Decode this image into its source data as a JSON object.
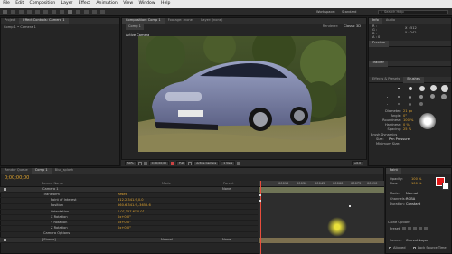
{
  "menu": [
    "File",
    "Edit",
    "Composition",
    "Layer",
    "Effect",
    "Animation",
    "View",
    "Window",
    "Help"
  ],
  "topbar": {
    "workspace_label": "Workspace:",
    "workspace_value": "Standard",
    "search_placeholder": "Search Help"
  },
  "project_panel": {
    "tabs": [
      "Project",
      "Effect Controls: Camera 1"
    ],
    "breadcrumb": "Comp 1 • Camera 1"
  },
  "comp_panel": {
    "tabs": [
      "Composition: Comp 1",
      "Footage: (none)",
      "Layer: (none)"
    ],
    "comp_label": "Comp 1",
    "active_camera_label": "Active Camera",
    "renderer_label": "Renderer:",
    "renderer_value": "Classic 3D"
  },
  "viewer_toolbar": {
    "zoom": "50%",
    "timecode": "0;00;00;00",
    "resolution": "Full",
    "camera": "Active Camera",
    "view": "1 View",
    "exposure": "+0.0"
  },
  "info_panel": {
    "tabs": [
      "Info",
      "Audio"
    ],
    "R": "R :",
    "G": "G :",
    "B": "B :",
    "A": "A : 0",
    "X": "X : 512",
    "Y": "Y : 242"
  },
  "preview_tab": "Preview",
  "tracker_tab": "Tracker",
  "effects_tabs": [
    "Effects & Presets",
    "Brushes"
  ],
  "brush_settings": {
    "diameter_label": "Diameter:",
    "diameter": "21 px",
    "angle_label": "Angle:",
    "angle": "0°",
    "roundness_label": "Roundness:",
    "roundness": "100 %",
    "hardness_label": "Hardness:",
    "hardness": "0 %",
    "spacing_label": "Spacing:",
    "spacing": "25 %",
    "dynamics_label": "Brush Dynamics",
    "size_label": "Size:",
    "size_value": "Pen Pressure",
    "min_size_label": "Minimum Size:"
  },
  "timeline": {
    "tabs": [
      "Render Queue",
      "Comp 1",
      "Blur_splash"
    ],
    "timecode": "0;00;00;00",
    "col_source": "Source Name",
    "col_parent": "Parent",
    "col_mode": "Mode",
    "layer_name": "Camera 1",
    "parent_value": "None",
    "properties": [
      {
        "name": "Transform",
        "value": "Reset"
      },
      {
        "name": "Point of Interest",
        "value": "512.2,341.9,0.0"
      },
      {
        "name": "Position",
        "value": "560.6,341.9,-3655.6"
      },
      {
        "name": "Orientation",
        "value": "0.0°,357.6°,0.0°"
      },
      {
        "name": "X Rotation",
        "value": "0x+0.0°"
      },
      {
        "name": "Y Rotation",
        "value": "0x+0.0°"
      },
      {
        "name": "Z Rotation",
        "value": "0x+0.0°"
      },
      {
        "name": "Camera Options",
        "value": ""
      }
    ],
    "layer2_name": "[Flower]",
    "layer2_mode": "Normal",
    "layer2_parent": "None",
    "ruler_labels": [
      "00015",
      "00030",
      "00045",
      "00060",
      "00075",
      "00090"
    ]
  },
  "paint_panel": {
    "tab": "Paint",
    "opacity_label": "Opacity:",
    "opacity": "100 %",
    "flow_label": "Flow:",
    "flow": "100 %",
    "mode_label": "Mode:",
    "mode": "Normal",
    "channels_label": "Channels:",
    "channels": "RGBA",
    "duration_label": "Duration:",
    "duration": "Constant",
    "clone_options": "Clone Options",
    "preset_label": "Preset:",
    "source_label": "Source:",
    "source": "Current Layer",
    "aligned_label": "Aligned",
    "lock_label": "Lock Source Time"
  },
  "colors": {
    "accent": "#e1a531",
    "paint_fg": "#e01818",
    "menu_bg": "#e9e9e9",
    "cursor_highlight": "#e9e03a"
  }
}
